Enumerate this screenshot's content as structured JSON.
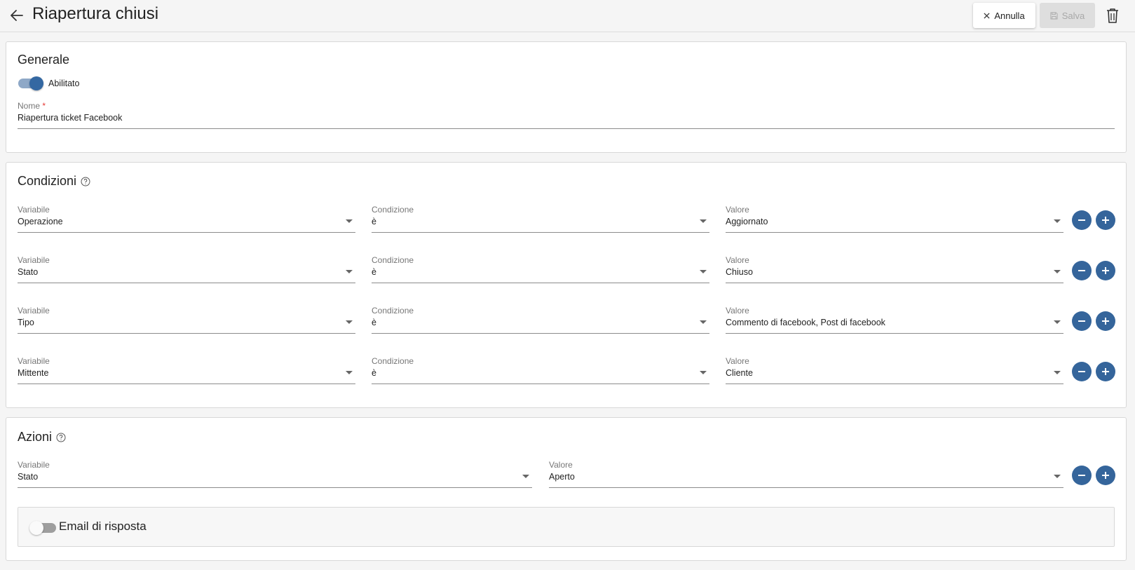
{
  "header": {
    "title": "Riapertura chiusi",
    "cancel_label": "Annulla",
    "save_label": "Salva"
  },
  "generale": {
    "title": "Generale",
    "enabled_label": "Abilitato",
    "enabled": true,
    "name_label": "Nome",
    "name_required_mark": "*",
    "name_value": "Riapertura ticket Facebook"
  },
  "condizioni": {
    "title": "Condizioni",
    "rows": [
      {
        "variable_label": "Variabile",
        "variable": "Operazione",
        "condition_label": "Condizione",
        "condition": "è",
        "value_label": "Valore",
        "value": "Aggiornato"
      },
      {
        "variable_label": "Variabile",
        "variable": "Stato",
        "condition_label": "Condizione",
        "condition": "è",
        "value_label": "Valore",
        "value": "Chiuso"
      },
      {
        "variable_label": "Variabile",
        "variable": "Tipo",
        "condition_label": "Condizione",
        "condition": "è",
        "value_label": "Valore",
        "value": "Commento di facebook, Post di facebook"
      },
      {
        "variable_label": "Variabile",
        "variable": "Mittente",
        "condition_label": "Condizione",
        "condition": "è",
        "value_label": "Valore",
        "value": "Cliente"
      }
    ]
  },
  "azioni": {
    "title": "Azioni",
    "rows": [
      {
        "variable_label": "Variabile",
        "variable": "Stato",
        "value_label": "Valore",
        "value": "Aperto"
      }
    ],
    "email_label": "Email di risposta",
    "email_enabled": false
  },
  "colors": {
    "accent": "#35659b",
    "toggle_track_on": "#8ea8c7",
    "required": "#e53935"
  }
}
